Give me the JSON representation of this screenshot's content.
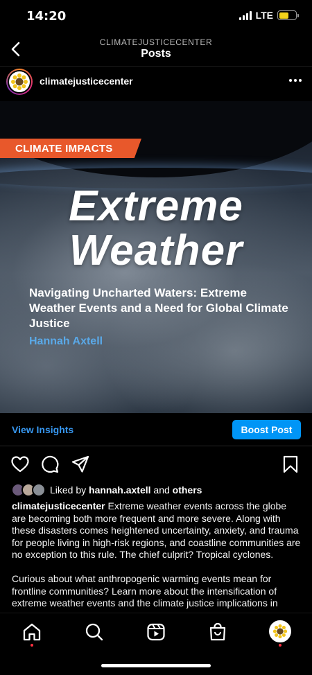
{
  "status_bar": {
    "time": "14:20",
    "network": "LTE"
  },
  "nav": {
    "account": "CLIMATEJUSTICECENTER",
    "title": "Posts"
  },
  "post": {
    "username": "climatejusticecenter",
    "image": {
      "tag": "CLIMATE IMPACTS",
      "headline_line1": "Extreme",
      "headline_line2": "Weather",
      "subtitle": "Navigating Uncharted Waters: Extreme Weather Events and a Need for Global Climate Justice",
      "author": "Hannah Axtell"
    },
    "insights_label": "View Insights",
    "boost_label": "Boost Post",
    "likes": {
      "prefix": "Liked by",
      "user": "hannah.axtell",
      "joiner": "and",
      "others": "others"
    },
    "caption": {
      "username": "climatejusticecenter",
      "text": "Extreme weather events across the globe are becoming both more frequent and more severe. Along with these disasters comes heightened uncertainty, anxiety, and trauma for people living in high-risk regions, and coastline communities are no exception to this rule. The chief culprit? Tropical cyclones.",
      "text2": "Curious about what anthropogenic warming events mean for frontline communities? Learn more about the intensification of extreme weather events and the climate justice implications in"
    }
  },
  "icons": {
    "back": "chevron-left-icon",
    "more": "more-horizontal-icon",
    "like": "heart-icon",
    "comment": "comment-icon",
    "share": "send-icon",
    "save": "bookmark-icon",
    "tabs": [
      "home-icon",
      "search-icon",
      "reels-icon",
      "shop-icon",
      "profile-avatar"
    ]
  },
  "colors": {
    "accent_blue": "#0095f6",
    "tag_orange": "#e8582b",
    "author_blue": "#5aa9e8",
    "notification_red": "#ff3040"
  }
}
